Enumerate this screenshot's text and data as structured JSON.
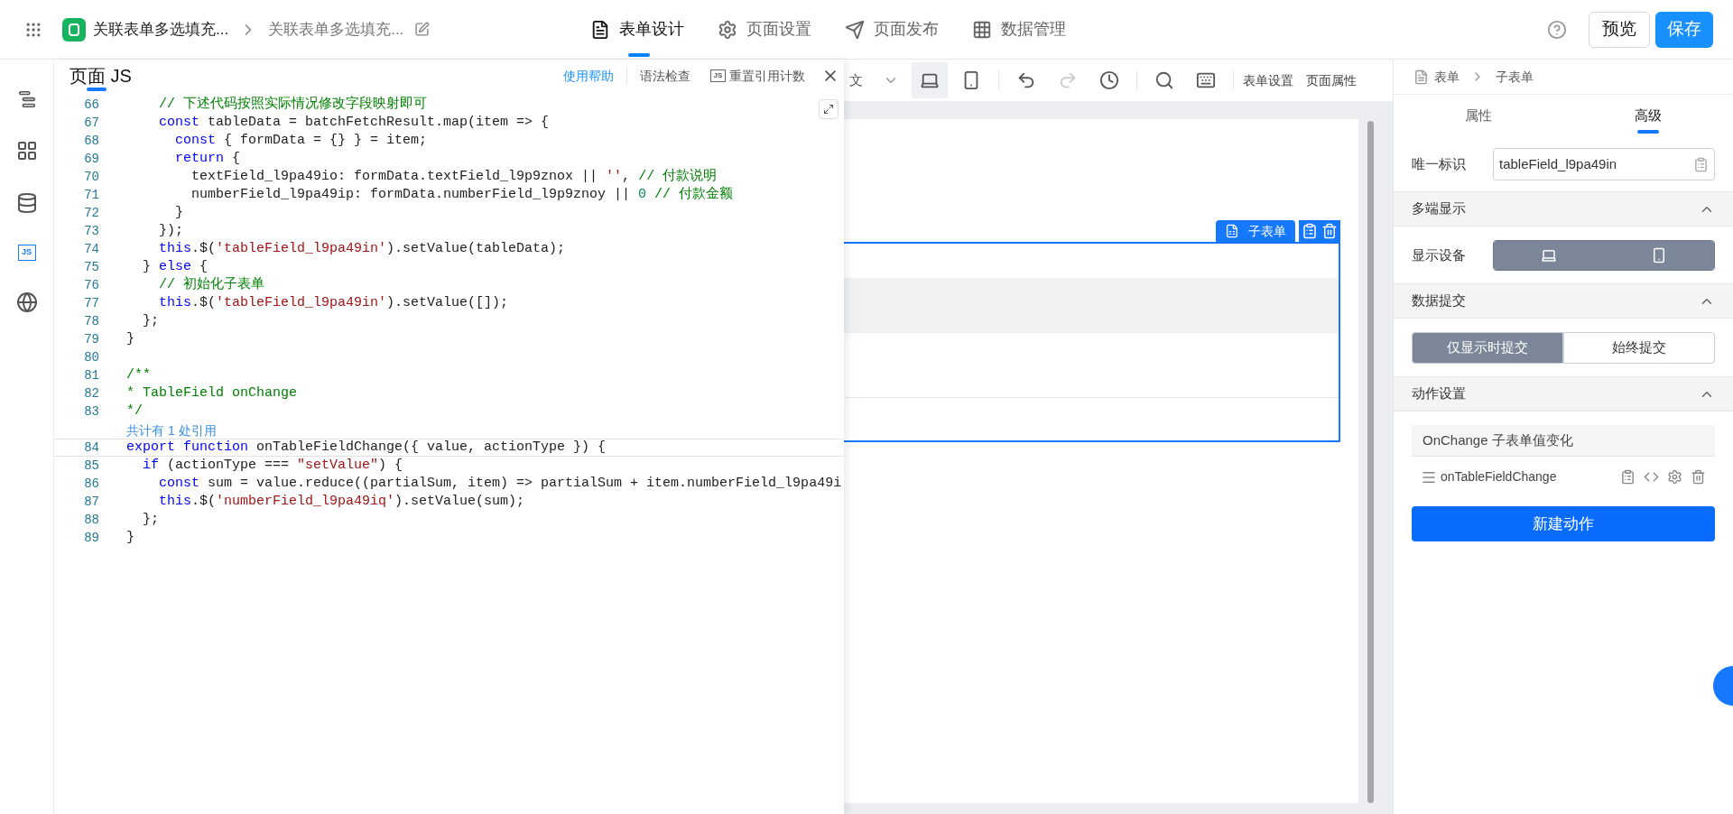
{
  "app_bar": {
    "app_title": "关联表单多选填充...",
    "page_title": "关联表单多选填充...",
    "tabs": [
      {
        "label": "表单设计",
        "kind": "document",
        "selected": true
      },
      {
        "label": "页面设置",
        "kind": "gear",
        "selected": false
      },
      {
        "label": "页面发布",
        "kind": "send",
        "selected": false
      },
      {
        "label": "数据管理",
        "kind": "grid",
        "selected": false
      }
    ],
    "preview": "预览",
    "save": "保存"
  },
  "side_rail": [
    {
      "kind": "outline",
      "selected": false
    },
    {
      "kind": "components",
      "selected": false
    },
    {
      "kind": "data",
      "selected": false
    },
    {
      "kind": "js",
      "label": "JS",
      "selected": true
    },
    {
      "kind": "globe",
      "selected": false
    }
  ],
  "code_panel": {
    "title": "页面 JS",
    "actions": [
      {
        "kind": "link",
        "label": "使用帮助"
      },
      {
        "kind": "text",
        "label": "语法检查"
      },
      {
        "kind": "badge",
        "badge": "JS",
        "label": "重置引用计数"
      }
    ],
    "lines": [
      {
        "kind": "code",
        "number": "66",
        "current": false,
        "tokens": [
          {
            "kind": "comment",
            "text": "    // 下述代码按照实际情况修改字段映射即可"
          }
        ]
      },
      {
        "kind": "code",
        "number": "67",
        "current": false,
        "tokens": [
          {
            "kind": "keyword",
            "text": "    const"
          },
          {
            "kind": "plain",
            "text": " tableData = batchFetchResult.map(item => {"
          }
        ]
      },
      {
        "kind": "code",
        "number": "68",
        "current": false,
        "tokens": [
          {
            "kind": "keyword",
            "text": "      const"
          },
          {
            "kind": "plain",
            "text": " { formData = {} } = item;"
          }
        ]
      },
      {
        "kind": "code",
        "number": "69",
        "current": false,
        "tokens": [
          {
            "kind": "keyword",
            "text": "      return"
          },
          {
            "kind": "plain",
            "text": " {"
          }
        ]
      },
      {
        "kind": "code",
        "number": "70",
        "current": false,
        "tokens": [
          {
            "kind": "plain",
            "text": "        textField_l9pa49io: formData.textField_l9p9znox || "
          },
          {
            "kind": "string",
            "text": "''"
          },
          {
            "kind": "plain",
            "text": ", "
          },
          {
            "kind": "comment",
            "text": "// 付款说明"
          }
        ]
      },
      {
        "kind": "code",
        "number": "71",
        "current": false,
        "tokens": [
          {
            "kind": "plain",
            "text": "        numberField_l9pa49ip: formData.numberField_l9p9znoy || "
          },
          {
            "kind": "number",
            "text": "0"
          },
          {
            "kind": "comment",
            "text": " // 付款金额"
          }
        ]
      },
      {
        "kind": "code",
        "number": "72",
        "current": false,
        "tokens": [
          {
            "kind": "plain",
            "text": "      }"
          }
        ]
      },
      {
        "kind": "code",
        "number": "73",
        "current": false,
        "tokens": [
          {
            "kind": "plain",
            "text": "    });"
          }
        ]
      },
      {
        "kind": "code",
        "number": "74",
        "current": false,
        "tokens": [
          {
            "kind": "keyword",
            "text": "    this"
          },
          {
            "kind": "plain",
            "text": ".$("
          },
          {
            "kind": "string",
            "text": "'tableField_l9pa49in'"
          },
          {
            "kind": "plain",
            "text": ").setValue(tableData);"
          }
        ]
      },
      {
        "kind": "code",
        "number": "75",
        "current": false,
        "tokens": [
          {
            "kind": "plain",
            "text": "  } "
          },
          {
            "kind": "keyword",
            "text": "else"
          },
          {
            "kind": "plain",
            "text": " {"
          }
        ]
      },
      {
        "kind": "code",
        "number": "76",
        "current": false,
        "tokens": [
          {
            "kind": "comment",
            "text": "    // 初始化子表单"
          }
        ]
      },
      {
        "kind": "code",
        "number": "77",
        "current": false,
        "tokens": [
          {
            "kind": "keyword",
            "text": "    this"
          },
          {
            "kind": "plain",
            "text": ".$("
          },
          {
            "kind": "string",
            "text": "'tableField_l9pa49in'"
          },
          {
            "kind": "plain",
            "text": ").setValue([]);"
          }
        ]
      },
      {
        "kind": "code",
        "number": "78",
        "current": false,
        "tokens": [
          {
            "kind": "plain",
            "text": "  };"
          }
        ]
      },
      {
        "kind": "code",
        "number": "79",
        "current": false,
        "tokens": [
          {
            "kind": "plain",
            "text": "}"
          }
        ]
      },
      {
        "kind": "code",
        "number": "80",
        "current": false
      },
      {
        "kind": "code",
        "number": "81",
        "current": false,
        "tokens": [
          {
            "kind": "comment",
            "text": "/**"
          }
        ]
      },
      {
        "kind": "code",
        "number": "82",
        "current": false,
        "tokens": [
          {
            "kind": "comment",
            "text": "* TableField onChange"
          }
        ]
      },
      {
        "kind": "code",
        "number": "83",
        "current": false,
        "tokens": [
          {
            "kind": "comment",
            "text": "*/"
          }
        ]
      },
      {
        "kind": "lens",
        "text": "共计有 1 处引用"
      },
      {
        "kind": "code",
        "number": "84",
        "current": true,
        "tokens": [
          {
            "kind": "keyword",
            "text": "export function"
          },
          {
            "kind": "plain",
            "text": " onTableFieldChange({ value, actionType }) {"
          }
        ]
      },
      {
        "kind": "code",
        "number": "85",
        "current": false,
        "tokens": [
          {
            "kind": "keyword",
            "text": "  if"
          },
          {
            "kind": "plain",
            "text": " (actionType === "
          },
          {
            "kind": "string",
            "text": "\"setValue\""
          },
          {
            "kind": "plain",
            "text": ") {"
          }
        ]
      },
      {
        "kind": "code",
        "number": "86",
        "current": false,
        "tokens": [
          {
            "kind": "keyword",
            "text": "    const"
          },
          {
            "kind": "plain",
            "text": " sum = value.reduce((partialSum, item) => partialSum + item.numberField_l9pa49i"
          }
        ]
      },
      {
        "kind": "code",
        "number": "87",
        "current": false,
        "tokens": [
          {
            "kind": "keyword",
            "text": "    this"
          },
          {
            "kind": "plain",
            "text": ".$("
          },
          {
            "kind": "string",
            "text": "'numberField_l9pa49iq'"
          },
          {
            "kind": "plain",
            "text": ").setValue(sum);"
          }
        ]
      },
      {
        "kind": "code",
        "number": "88",
        "current": false,
        "tokens": [
          {
            "kind": "plain",
            "text": "  };"
          }
        ]
      },
      {
        "kind": "code",
        "number": "89",
        "current": false,
        "tokens": [
          {
            "kind": "plain",
            "text": "}"
          }
        ]
      }
    ]
  },
  "canvas": {
    "language": "文",
    "toolbar": [
      {
        "kind": "laptop",
        "selected": true,
        "disabled": false
      },
      {
        "kind": "phone",
        "selected": false,
        "disabled": false
      },
      {
        "kind": "undo",
        "selected": false,
        "disabled": false
      },
      {
        "kind": "redo",
        "selected": false,
        "disabled": true
      },
      {
        "kind": "history",
        "selected": false,
        "disabled": false
      },
      {
        "kind": "search",
        "selected": false,
        "disabled": false
      },
      {
        "kind": "keyboard",
        "selected": false,
        "disabled": false
      }
    ],
    "links": [
      "表单设置",
      "页面属性"
    ],
    "selected_component": "子表单"
  },
  "inspector": {
    "breadcrumb": [
      "表单",
      "子表单"
    ],
    "tabs": [
      {
        "label": "属性",
        "selected": false
      },
      {
        "label": "高级",
        "selected": true
      }
    ],
    "id_field": {
      "label": "唯一标识",
      "value": "tableField_l9pa49in"
    },
    "sections": [
      {
        "kind": "devices",
        "title": "多端显示",
        "expanded": true,
        "label": "显示设备",
        "options": [
          {
            "kind": "laptop",
            "selected": true
          },
          {
            "kind": "phone",
            "selected": true
          }
        ]
      },
      {
        "kind": "segmented",
        "title": "数据提交",
        "expanded": true,
        "options": [
          {
            "label": "仅显示时提交",
            "selected": true
          },
          {
            "label": "始终提交",
            "selected": false
          }
        ]
      },
      {
        "kind": "actions",
        "title": "动作设置",
        "expanded": true,
        "event": "OnChange 子表单值变化",
        "actions": [
          {
            "name": "onTableFieldChange"
          }
        ],
        "button": "新建动作"
      }
    ]
  }
}
